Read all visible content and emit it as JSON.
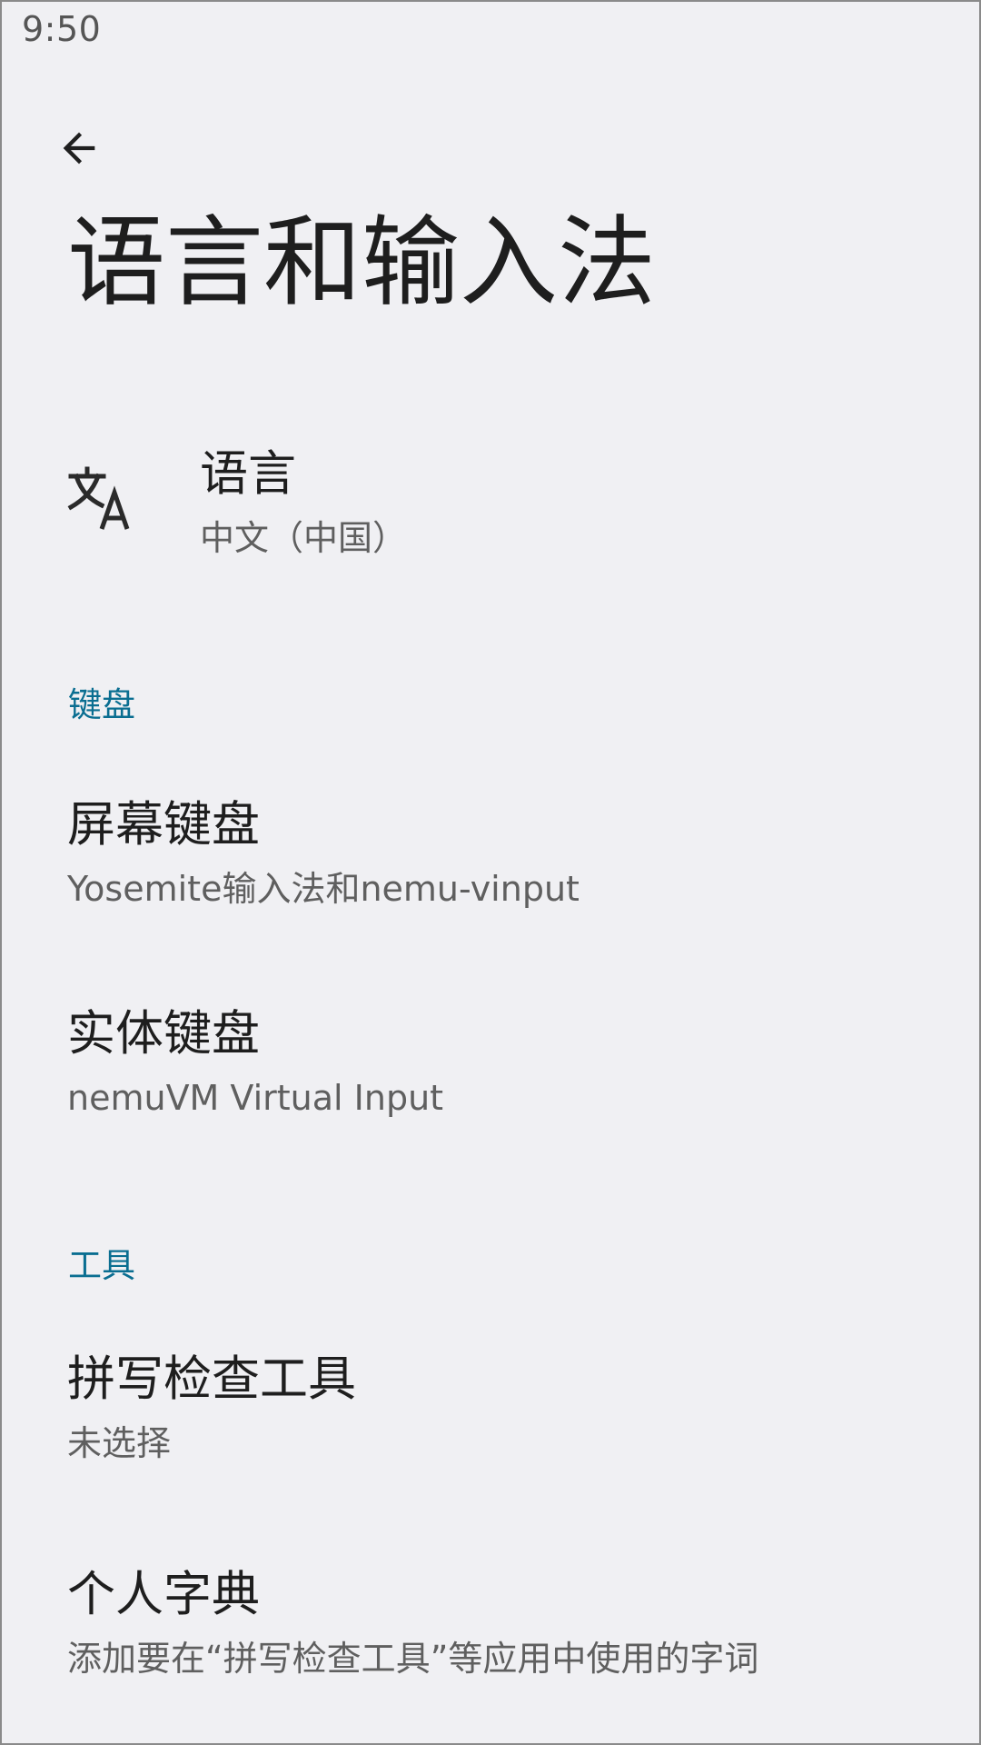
{
  "status_bar": {
    "time": "9:50"
  },
  "header": {
    "back_icon": "arrow-left-icon",
    "title": "语言和输入法"
  },
  "language": {
    "icon": "translate-icon",
    "title": "语言",
    "summary": "中文（中国）"
  },
  "sections": {
    "keyboard": {
      "header": "键盘",
      "items": [
        {
          "title": "屏幕键盘",
          "summary": "Yosemite输入法和nemu-vinput"
        },
        {
          "title": "实体键盘",
          "summary": "nemuVM Virtual Input"
        }
      ]
    },
    "tools": {
      "header": "工具",
      "items": [
        {
          "title": "拼写检查工具",
          "summary": "未选择"
        },
        {
          "title": "个人字典",
          "summary": "添加要在“拼写检查工具”等应用中使用的字词"
        }
      ]
    }
  },
  "colors": {
    "background": "#f0f0f3",
    "accent": "#0a6e91",
    "primary_text": "#1e1e1e",
    "secondary_text": "#5f5f5f"
  }
}
